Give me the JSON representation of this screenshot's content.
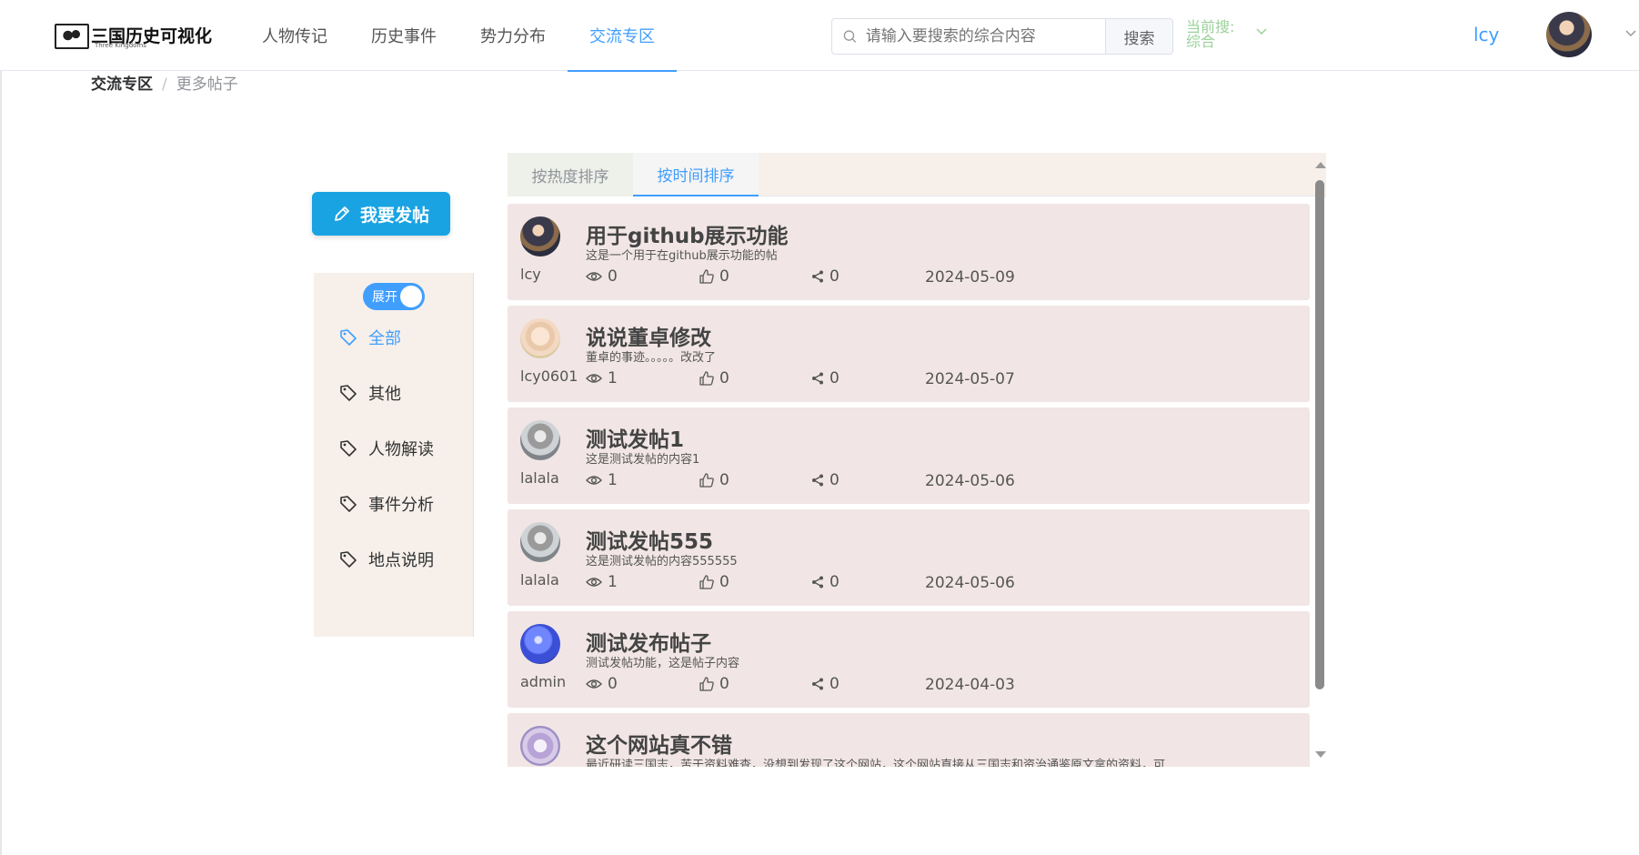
{
  "header": {
    "logo_text": "三国历史可视化",
    "logo_sub": "Three Kingdoms",
    "nav": [
      {
        "label": "人物传记"
      },
      {
        "label": "历史事件"
      },
      {
        "label": "势力分布"
      },
      {
        "label": "交流专区"
      }
    ],
    "search_placeholder": "请输入要搜索的综合内容",
    "search_button": "搜索",
    "search_scope": "当前搜: 综合",
    "username": "lcy"
  },
  "breadcrumb": {
    "root": "交流专区",
    "sep": "/",
    "current": "更多帖子"
  },
  "post_button": "我要发帖",
  "side": {
    "toggle_label": "展开",
    "categories": [
      {
        "label": "全部"
      },
      {
        "label": "其他"
      },
      {
        "label": "人物解读"
      },
      {
        "label": "事件分析"
      },
      {
        "label": "地点说明"
      }
    ]
  },
  "tabs": [
    {
      "label": "按热度排序"
    },
    {
      "label": "按时间排序"
    }
  ],
  "posts": [
    {
      "user": "lcy",
      "title": "用于github展示功能",
      "excerpt": "这是一个用于在github展示功能的帖",
      "views": "0",
      "likes": "0",
      "shares": "0",
      "date": "2024-05-09"
    },
    {
      "user": "lcy0601",
      "title": "说说董卓修改",
      "excerpt": "董卓的事迹。。。。。改改了",
      "views": "1",
      "likes": "0",
      "shares": "0",
      "date": "2024-05-07"
    },
    {
      "user": "lalala",
      "title": "测试发帖1",
      "excerpt": "这是测试发帖的内容1",
      "views": "1",
      "likes": "0",
      "shares": "0",
      "date": "2024-05-06"
    },
    {
      "user": "lalala",
      "title": "测试发帖555",
      "excerpt": "这是测试发帖的内容555555",
      "views": "1",
      "likes": "0",
      "shares": "0",
      "date": "2024-05-06"
    },
    {
      "user": "admin",
      "title": "测试发布帖子",
      "excerpt": "测试发帖功能，这是帖子内容",
      "views": "0",
      "likes": "0",
      "shares": "0",
      "date": "2024-04-03"
    },
    {
      "user": "",
      "title": "这个网站真不错",
      "excerpt": "最近研读三国志，苦于资料难查，没想到发现了这个网站，这个网站直接从三国志和资治通鉴原文拿的资料，可",
      "views": "",
      "likes": "",
      "shares": "",
      "date": ""
    }
  ],
  "colors": {
    "accent": "#409eff",
    "post_button": "#1aa3e2",
    "post_bg": "#f1e6e5",
    "side_bg": "#f7f0ea"
  }
}
